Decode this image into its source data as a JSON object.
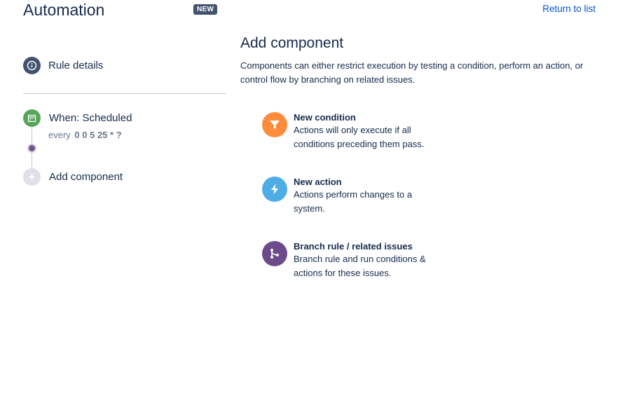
{
  "header": {
    "title": "Automation",
    "badge": "NEW",
    "return_link": "Return to list"
  },
  "sidebar": {
    "rule_details": "Rule details",
    "trigger": {
      "title": "When: Scheduled",
      "prefix": "every",
      "cron": "0 0 5 25 * ?"
    },
    "add_component": "Add component"
  },
  "main": {
    "title": "Add component",
    "description": "Components can either restrict execution by testing a condition, perform an action, or control flow by branching on related issues.",
    "options": [
      {
        "title": "New condition",
        "description": "Actions will only execute if all conditions preceding them pass.",
        "icon": "filter-icon",
        "color": "#ff8b3d"
      },
      {
        "title": "New action",
        "description": "Actions perform changes to a system.",
        "icon": "lightning-icon",
        "color": "#4fade6"
      },
      {
        "title": "Branch rule / related issues",
        "description": "Branch rule and run conditions & actions for these issues.",
        "icon": "branch-icon",
        "color": "#6b4b8a"
      }
    ]
  }
}
